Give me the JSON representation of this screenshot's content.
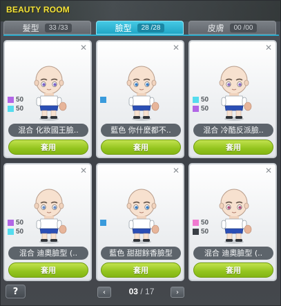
{
  "window": {
    "title": "BEAUTY ROOM"
  },
  "tabs": [
    {
      "label": "髮型",
      "count": "33 /33",
      "active": false
    },
    {
      "label": "臉型",
      "count": "28 /28",
      "active": true
    },
    {
      "label": "皮膚",
      "count": "00 /00",
      "active": false
    }
  ],
  "cards": [
    {
      "name": "混合  化妝國王臉..",
      "apply_label": "套用",
      "close_icon": "close-icon",
      "swatches": [
        {
          "color": "#b266e6",
          "value": "50"
        },
        {
          "color": "#55dcee",
          "value": "50"
        }
      ],
      "eye_color": "#7a63c8",
      "brow_color": "#6b5a4e"
    },
    {
      "name": "藍色  你什麼都不..",
      "apply_label": "套用",
      "close_icon": "close-icon",
      "swatches": [
        {
          "color": "#3a9bdc",
          "value": ""
        }
      ],
      "eye_color": "#3b7fc5",
      "brow_color": "#6b5a4e"
    },
    {
      "name": "混合  冷酷反派臉..",
      "apply_label": "套用",
      "close_icon": "close-icon",
      "swatches": [
        {
          "color": "#55dcee",
          "value": "50"
        },
        {
          "color": "#b266e6",
          "value": "50"
        }
      ],
      "eye_color": "#8a6cc0",
      "brow_color": "#6b5a4e"
    },
    {
      "name": "混合  迪奧臉型 (..",
      "apply_label": "套用",
      "close_icon": "close-icon",
      "swatches": [
        {
          "color": "#b266e6",
          "value": "50"
        },
        {
          "color": "#55dcee",
          "value": "50"
        }
      ],
      "eye_color": "#6a8ec8",
      "brow_color": "#6b5a4e"
    },
    {
      "name": "藍色  甜甜餘香臉型",
      "apply_label": "套用",
      "close_icon": "close-icon",
      "swatches": [
        {
          "color": "#3a9bdc",
          "value": ""
        }
      ],
      "eye_color": "#3b7fc5",
      "brow_color": "#6b5a4e"
    },
    {
      "name": "混合  迪奧臉型 (..",
      "apply_label": "套用",
      "close_icon": "close-icon",
      "swatches": [
        {
          "color": "#f07ad0",
          "value": "50"
        },
        {
          "color": "#3a3f45",
          "value": "50"
        }
      ],
      "eye_color": "#b0507a",
      "brow_color": "#6b5a4e"
    }
  ],
  "footer": {
    "help_label": "?",
    "prev_label": "‹",
    "next_label": "›",
    "current_page": "03",
    "separator": "/",
    "total_pages": "17"
  }
}
